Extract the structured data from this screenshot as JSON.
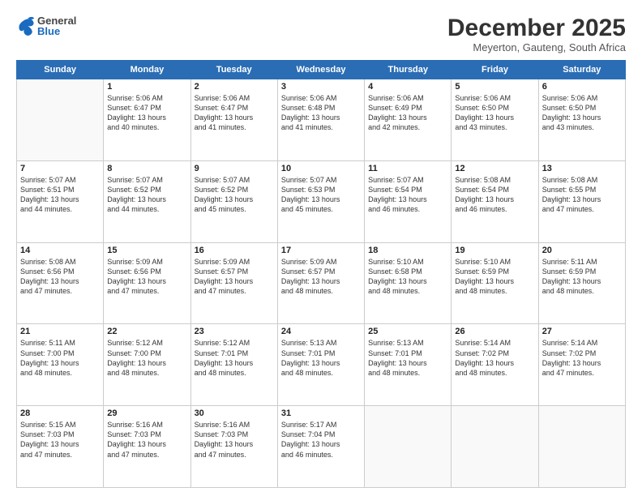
{
  "header": {
    "logo": {
      "general": "General",
      "blue": "Blue"
    },
    "title": "December 2025",
    "location": "Meyerton, Gauteng, South Africa"
  },
  "days_of_week": [
    "Sunday",
    "Monday",
    "Tuesday",
    "Wednesday",
    "Thursday",
    "Friday",
    "Saturday"
  ],
  "weeks": [
    [
      {
        "day": "",
        "sunrise": "",
        "sunset": "",
        "daylight": ""
      },
      {
        "day": "1",
        "sunrise": "Sunrise: 5:06 AM",
        "sunset": "Sunset: 6:47 PM",
        "daylight": "Daylight: 13 hours and 40 minutes."
      },
      {
        "day": "2",
        "sunrise": "Sunrise: 5:06 AM",
        "sunset": "Sunset: 6:47 PM",
        "daylight": "Daylight: 13 hours and 41 minutes."
      },
      {
        "day": "3",
        "sunrise": "Sunrise: 5:06 AM",
        "sunset": "Sunset: 6:48 PM",
        "daylight": "Daylight: 13 hours and 41 minutes."
      },
      {
        "day": "4",
        "sunrise": "Sunrise: 5:06 AM",
        "sunset": "Sunset: 6:49 PM",
        "daylight": "Daylight: 13 hours and 42 minutes."
      },
      {
        "day": "5",
        "sunrise": "Sunrise: 5:06 AM",
        "sunset": "Sunset: 6:50 PM",
        "daylight": "Daylight: 13 hours and 43 minutes."
      },
      {
        "day": "6",
        "sunrise": "Sunrise: 5:06 AM",
        "sunset": "Sunset: 6:50 PM",
        "daylight": "Daylight: 13 hours and 43 minutes."
      }
    ],
    [
      {
        "day": "7",
        "sunrise": "Sunrise: 5:07 AM",
        "sunset": "Sunset: 6:51 PM",
        "daylight": "Daylight: 13 hours and 44 minutes."
      },
      {
        "day": "8",
        "sunrise": "Sunrise: 5:07 AM",
        "sunset": "Sunset: 6:52 PM",
        "daylight": "Daylight: 13 hours and 44 minutes."
      },
      {
        "day": "9",
        "sunrise": "Sunrise: 5:07 AM",
        "sunset": "Sunset: 6:52 PM",
        "daylight": "Daylight: 13 hours and 45 minutes."
      },
      {
        "day": "10",
        "sunrise": "Sunrise: 5:07 AM",
        "sunset": "Sunset: 6:53 PM",
        "daylight": "Daylight: 13 hours and 45 minutes."
      },
      {
        "day": "11",
        "sunrise": "Sunrise: 5:07 AM",
        "sunset": "Sunset: 6:54 PM",
        "daylight": "Daylight: 13 hours and 46 minutes."
      },
      {
        "day": "12",
        "sunrise": "Sunrise: 5:08 AM",
        "sunset": "Sunset: 6:54 PM",
        "daylight": "Daylight: 13 hours and 46 minutes."
      },
      {
        "day": "13",
        "sunrise": "Sunrise: 5:08 AM",
        "sunset": "Sunset: 6:55 PM",
        "daylight": "Daylight: 13 hours and 47 minutes."
      }
    ],
    [
      {
        "day": "14",
        "sunrise": "Sunrise: 5:08 AM",
        "sunset": "Sunset: 6:56 PM",
        "daylight": "Daylight: 13 hours and 47 minutes."
      },
      {
        "day": "15",
        "sunrise": "Sunrise: 5:09 AM",
        "sunset": "Sunset: 6:56 PM",
        "daylight": "Daylight: 13 hours and 47 minutes."
      },
      {
        "day": "16",
        "sunrise": "Sunrise: 5:09 AM",
        "sunset": "Sunset: 6:57 PM",
        "daylight": "Daylight: 13 hours and 47 minutes."
      },
      {
        "day": "17",
        "sunrise": "Sunrise: 5:09 AM",
        "sunset": "Sunset: 6:57 PM",
        "daylight": "Daylight: 13 hours and 48 minutes."
      },
      {
        "day": "18",
        "sunrise": "Sunrise: 5:10 AM",
        "sunset": "Sunset: 6:58 PM",
        "daylight": "Daylight: 13 hours and 48 minutes."
      },
      {
        "day": "19",
        "sunrise": "Sunrise: 5:10 AM",
        "sunset": "Sunset: 6:59 PM",
        "daylight": "Daylight: 13 hours and 48 minutes."
      },
      {
        "day": "20",
        "sunrise": "Sunrise: 5:11 AM",
        "sunset": "Sunset: 6:59 PM",
        "daylight": "Daylight: 13 hours and 48 minutes."
      }
    ],
    [
      {
        "day": "21",
        "sunrise": "Sunrise: 5:11 AM",
        "sunset": "Sunset: 7:00 PM",
        "daylight": "Daylight: 13 hours and 48 minutes."
      },
      {
        "day": "22",
        "sunrise": "Sunrise: 5:12 AM",
        "sunset": "Sunset: 7:00 PM",
        "daylight": "Daylight: 13 hours and 48 minutes."
      },
      {
        "day": "23",
        "sunrise": "Sunrise: 5:12 AM",
        "sunset": "Sunset: 7:01 PM",
        "daylight": "Daylight: 13 hours and 48 minutes."
      },
      {
        "day": "24",
        "sunrise": "Sunrise: 5:13 AM",
        "sunset": "Sunset: 7:01 PM",
        "daylight": "Daylight: 13 hours and 48 minutes."
      },
      {
        "day": "25",
        "sunrise": "Sunrise: 5:13 AM",
        "sunset": "Sunset: 7:01 PM",
        "daylight": "Daylight: 13 hours and 48 minutes."
      },
      {
        "day": "26",
        "sunrise": "Sunrise: 5:14 AM",
        "sunset": "Sunset: 7:02 PM",
        "daylight": "Daylight: 13 hours and 48 minutes."
      },
      {
        "day": "27",
        "sunrise": "Sunrise: 5:14 AM",
        "sunset": "Sunset: 7:02 PM",
        "daylight": "Daylight: 13 hours and 47 minutes."
      }
    ],
    [
      {
        "day": "28",
        "sunrise": "Sunrise: 5:15 AM",
        "sunset": "Sunset: 7:03 PM",
        "daylight": "Daylight: 13 hours and 47 minutes."
      },
      {
        "day": "29",
        "sunrise": "Sunrise: 5:16 AM",
        "sunset": "Sunset: 7:03 PM",
        "daylight": "Daylight: 13 hours and 47 minutes."
      },
      {
        "day": "30",
        "sunrise": "Sunrise: 5:16 AM",
        "sunset": "Sunset: 7:03 PM",
        "daylight": "Daylight: 13 hours and 47 minutes."
      },
      {
        "day": "31",
        "sunrise": "Sunrise: 5:17 AM",
        "sunset": "Sunset: 7:04 PM",
        "daylight": "Daylight: 13 hours and 46 minutes."
      },
      {
        "day": "",
        "sunrise": "",
        "sunset": "",
        "daylight": ""
      },
      {
        "day": "",
        "sunrise": "",
        "sunset": "",
        "daylight": ""
      },
      {
        "day": "",
        "sunrise": "",
        "sunset": "",
        "daylight": ""
      }
    ]
  ]
}
